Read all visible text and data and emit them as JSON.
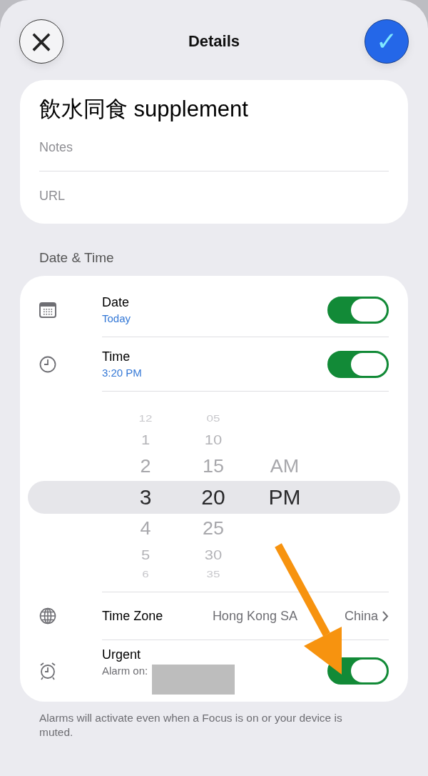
{
  "header": {
    "title": "Details",
    "cancel_label": "×",
    "confirm_label": "✓"
  },
  "reminder": {
    "title": "飲水同食 supplement",
    "notes_placeholder": "Notes",
    "url_placeholder": "URL"
  },
  "section_title": "Date & Time",
  "rows": [
    {
      "kind": "date",
      "label": "Date",
      "value": "Today",
      "on": true
    },
    {
      "kind": "time",
      "label": "Time",
      "value": "3:20 PM",
      "on": true
    }
  ],
  "picker": {
    "columns": [
      {
        "items": [
          {
            "text": "12",
            "selected": false
          },
          {
            "text": "1",
            "selected": false
          },
          {
            "text": "2",
            "selected": false
          },
          {
            "text": "3",
            "selected": true
          },
          {
            "text": "4",
            "selected": false
          },
          {
            "text": "5",
            "selected": false
          },
          {
            "text": "6",
            "selected": false
          }
        ]
      },
      {
        "items": [
          {
            "text": "05",
            "selected": false
          },
          {
            "text": "10",
            "selected": false
          },
          {
            "text": "15",
            "selected": false
          },
          {
            "text": "20",
            "selected": true
          },
          {
            "text": "25",
            "selected": false
          },
          {
            "text": "30",
            "selected": false
          },
          {
            "text": "35",
            "selected": false
          }
        ]
      },
      {
        "items": [
          {
            "text": "AM",
            "selected": false
          },
          {
            "text": "PM",
            "selected": true
          }
        ]
      }
    ]
  },
  "time_zone": {
    "label": "Time Zone",
    "value_parts": [
      "Hong Kong SA",
      "China"
    ]
  },
  "urgent": {
    "label": "Urgent",
    "subtitle": "Alarm on:",
    "on": true
  },
  "footnote": "Alarms will activate even when a Focus is on or your device is muted."
}
